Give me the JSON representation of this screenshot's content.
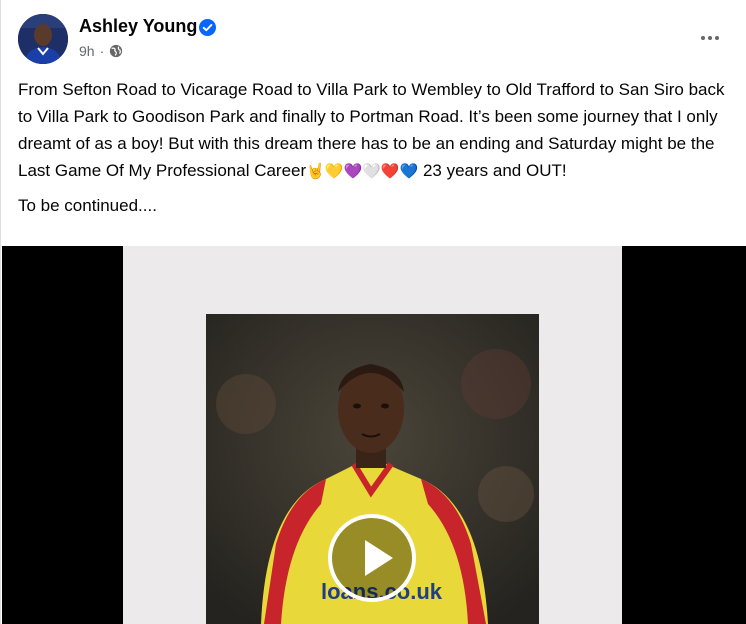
{
  "author": {
    "name": "Ashley Young",
    "verified_icon": "verified-badge-icon",
    "avatar_icon": "avatar"
  },
  "meta": {
    "timestamp": "9h",
    "separator": "·",
    "audience_icon": "globe-icon"
  },
  "post": {
    "text_main": "From Sefton Road to Vicarage Road to Villa Park to Wembley to Old Trafford to San Siro back to Villa Park to Goodison Park and finally to Portman Road. It’s been some journey that I only dreamt of as a boy! But with this dream there has to be an ending and Saturday might be the Last Game Of My Professional Career",
    "emojis": "🤘💛💜🤍❤️💙",
    "text_tail": " 23 years and OUT!",
    "text_continue": "To be continued...."
  },
  "media": {
    "type": "video",
    "play_icon": "play-icon",
    "shirt_sponsor": "loans.co.uk"
  },
  "colors": {
    "verified": "#0866ff",
    "secondary_text": "#65676b",
    "shirt_yellow": "#e8d83a",
    "shirt_red": "#c8242b"
  }
}
